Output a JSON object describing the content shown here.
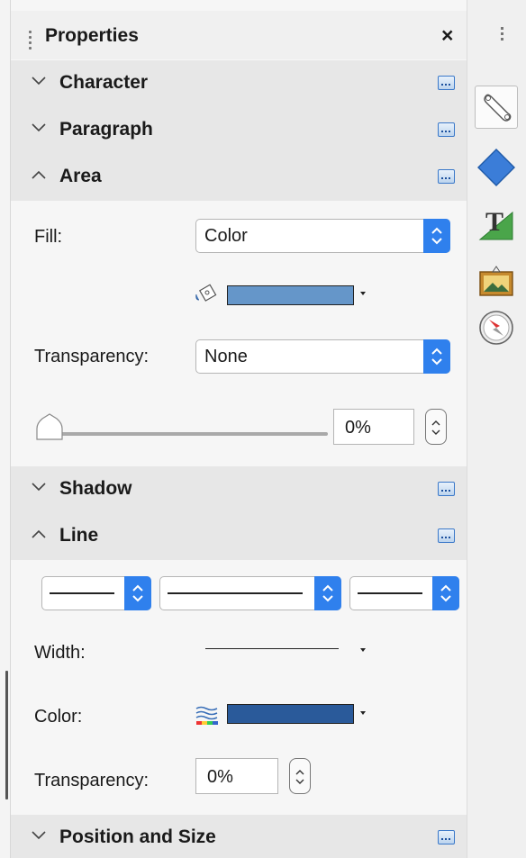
{
  "panel": {
    "title": "Properties",
    "close_glyph": "✕"
  },
  "sections": {
    "character": {
      "title": "Character",
      "expanded": false
    },
    "paragraph": {
      "title": "Paragraph",
      "expanded": false
    },
    "area": {
      "title": "Area",
      "expanded": true,
      "fill_label": "Fill:",
      "fill_value": "Color",
      "fill_color": "#6596c9",
      "transparency_label": "Transparency:",
      "transparency_value": "None",
      "transparency_percent": "0%",
      "slider_fraction": 0
    },
    "shadow": {
      "title": "Shadow",
      "expanded": false
    },
    "line": {
      "title": "Line",
      "expanded": true,
      "width_label": "Width:",
      "color_label": "Color:",
      "line_color": "#2a5a9a",
      "transparency_label": "Transparency:",
      "transparency_value": "0%"
    },
    "position_size": {
      "title": "Position and Size",
      "expanded": false
    }
  },
  "deck": {
    "items": [
      "properties-wrench-icon",
      "styles-diamond-icon",
      "fontwork-text-icon",
      "gallery-picture-icon",
      "navigator-compass-icon"
    ],
    "selected": "properties-wrench-icon"
  },
  "colors": {
    "accent": "#2f80ed",
    "section_bg": "#e7e7e7"
  }
}
